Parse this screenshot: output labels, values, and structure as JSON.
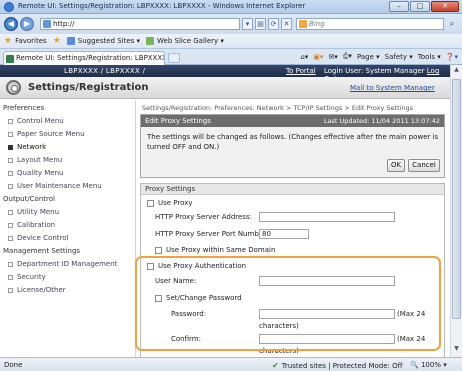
{
  "window": {
    "title": "Remote UI: Settings/Registration: LBPXXXX: LBPXXXX - Windows Internet Explorer",
    "buttons": {
      "minimize": "–",
      "maximize": "□",
      "close": "✕"
    }
  },
  "address_bar": {
    "url": "http://",
    "search_placeholder": "Bing",
    "back_icon": "back-arrow-icon",
    "forward_icon": "forward-arrow-icon"
  },
  "favorites_bar": {
    "favorites_label": "Favorites",
    "suggested_sites": "Suggested Sites ▾",
    "web_slice_gallery": "Web Slice Gallery ▾"
  },
  "tab": {
    "label": "Remote UI: Settings/Registration: LBPXXXX: LBPXX..."
  },
  "command_bar": {
    "page": "Page ▾",
    "safety": "Safety ▾",
    "tools": "Tools ▾"
  },
  "banner": {
    "model": "LBPXXXX / LBPXXXX /",
    "to_portal": "To Portal",
    "login_user_prefix": "Login User: System Manager",
    "log_out": "Log Out"
  },
  "header": {
    "title": "Settings/Registration",
    "mail_link": "Mail to System Manager"
  },
  "sidebar": {
    "categories": [
      {
        "label": "Preferences",
        "items": [
          "Control Menu",
          "Paper Source Menu",
          "Network",
          "Layout Menu",
          "Quality Menu",
          "User Maintenance Menu"
        ]
      },
      {
        "label": "Output/Control",
        "items": [
          "Utility Menu",
          "Calibration",
          "Device Control"
        ]
      },
      {
        "label": "Management Settings",
        "items": [
          "Department ID Management",
          "Security",
          "License/Other"
        ]
      }
    ],
    "active_item": "Network"
  },
  "breadcrumb": "Settings/Registration: Preferences: Network > TCP/IP Settings > Edit Proxy Settings",
  "edit_panel": {
    "title": "Edit Proxy Settings",
    "last_updated": "Last Updated: 11/04 2011 13:07:42",
    "message": "The settings will be changed as follows. (Changes effective after the main power is turned OFF and ON.)",
    "ok_label": "OK",
    "cancel_label": "Cancel"
  },
  "proxy_settings": {
    "section_title": "Proxy Settings",
    "use_proxy_label": "Use Proxy",
    "server_address_label": "HTTP Proxy Server Address:",
    "server_address_value": "",
    "server_port_label": "HTTP Proxy Server Port Number:",
    "server_port_value": "80",
    "same_domain_label": "Use Proxy within Same Domain",
    "use_auth_label": "Use Proxy Authentication",
    "user_name_label": "User Name:",
    "user_name_value": "",
    "set_change_password_label": "Set/Change Password",
    "password_label": "Password:",
    "password_value": "",
    "password_hint_1": "(Max 24",
    "password_hint_2": "characters)",
    "confirm_label": "Confirm:",
    "confirm_value": "",
    "confirm_hint_1": "(Max 24",
    "confirm_hint_2": "characters)"
  },
  "status_bar": {
    "status": "Done",
    "zone": "Trusted sites | Protected Mode: Off",
    "zoom": "100%  ▾"
  }
}
